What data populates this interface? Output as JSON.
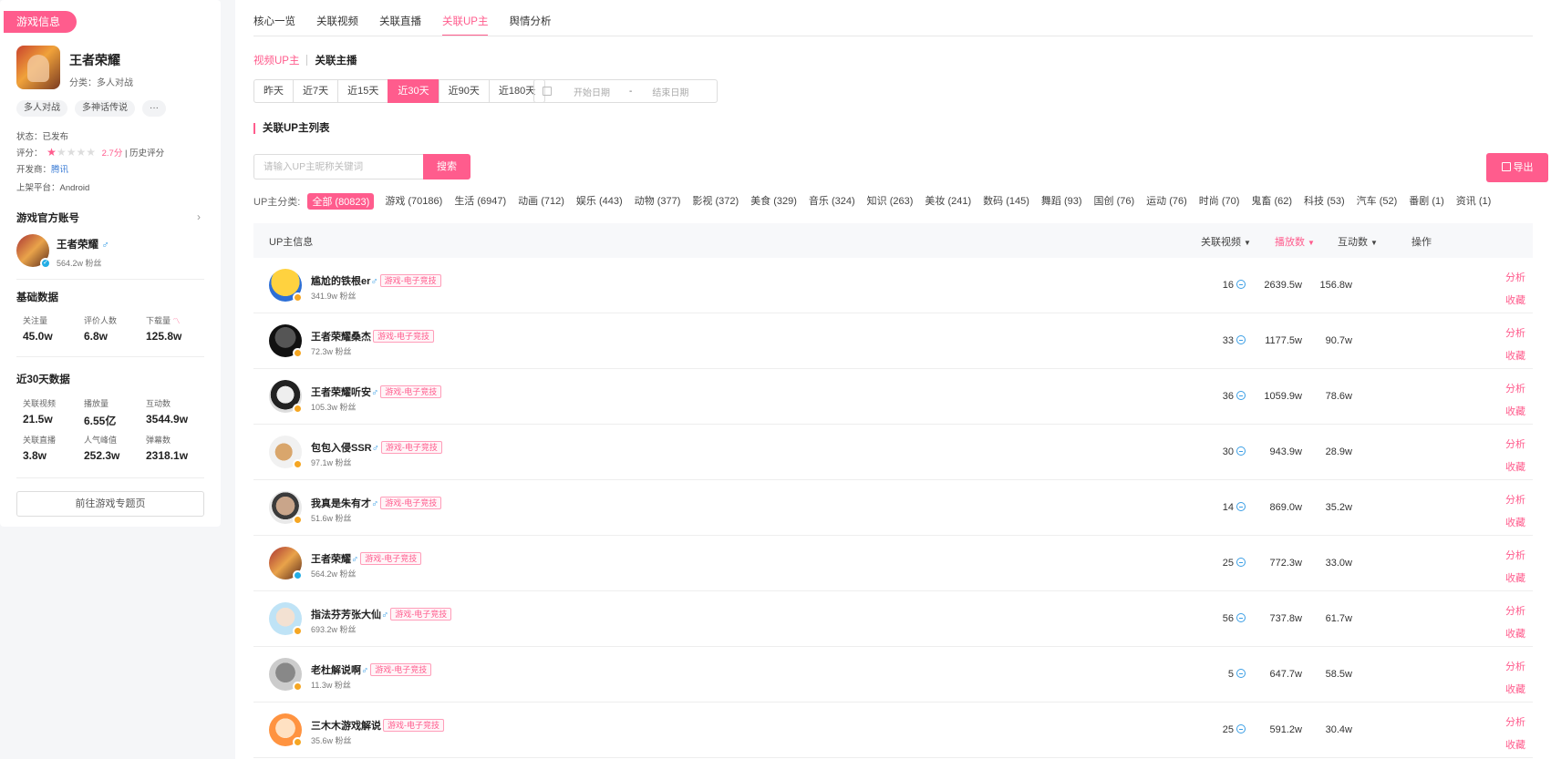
{
  "sidebar": {
    "tag": "游戏信息",
    "game_name": "王者荣耀",
    "category": "分类：多人对战",
    "chips": [
      "多人对战",
      "多神话传说",
      "···"
    ],
    "status": "状态：已发布",
    "rating_label": "评分：",
    "rating_score": "2.7分",
    "rating_history": "| 历史评分",
    "developer_label": "开发商：",
    "developer": "腾讯",
    "platform": "上架平台：Android",
    "official_title": "游戏官方账号",
    "official_name": "王者荣耀",
    "official_fans": "564.2w 粉丝",
    "basic_title": "基础数据",
    "basic": [
      {
        "label": "关注量",
        "value": "45.0w"
      },
      {
        "label": "评价人数",
        "value": "6.8w"
      },
      {
        "label": "下载量",
        "value": "125.8w"
      }
    ],
    "recent_title": "近30天数据",
    "recent": [
      {
        "label": "关联视频",
        "value": "21.5w"
      },
      {
        "label": "播放量",
        "value": "6.55亿"
      },
      {
        "label": "互动数",
        "value": "3544.9w"
      },
      {
        "label": "关联直播",
        "value": "3.8w"
      },
      {
        "label": "人气峰值",
        "value": "252.3w"
      },
      {
        "label": "弹幕数",
        "value": "2318.1w"
      }
    ],
    "goto_button": "前往游戏专题页"
  },
  "tabs": [
    "核心一览",
    "关联视频",
    "关联直播",
    "关联UP主",
    "舆情分析"
  ],
  "subtabs": [
    "视频UP主",
    "关联主播"
  ],
  "ranges": [
    "昨天",
    "近7天",
    "近15天",
    "近30天",
    "近90天",
    "近180天"
  ],
  "date": {
    "start": "开始日期",
    "sep": "-",
    "end": "结束日期"
  },
  "list_title": "关联UP主列表",
  "search": {
    "placeholder": "请输入UP主昵称关键词",
    "button": "搜索"
  },
  "export": "导出",
  "cats_label": "UP主分类:",
  "categories": [
    "全部 (80823)",
    "游戏 (70186)",
    "生活 (6947)",
    "动画 (712)",
    "娱乐 (443)",
    "动物 (377)",
    "影视 (372)",
    "美食 (329)",
    "音乐 (324)",
    "知识 (263)",
    "美妆 (241)",
    "数码 (145)",
    "舞蹈 (93)",
    "国创 (76)",
    "运动 (76)",
    "时尚 (70)",
    "鬼畜 (62)",
    "科技 (53)",
    "汽车 (52)",
    "番剧 (1)",
    "资讯 (1)"
  ],
  "table_head": {
    "info": "UP主信息",
    "videos": "关联视频",
    "plays": "播放数",
    "interactions": "互动数",
    "ops": "操作"
  },
  "rows": [
    {
      "name": "尴尬的铁根er",
      "male": "♂",
      "tag": "游戏-电子竞技",
      "fans": "341.9w 粉丝",
      "videos": "16",
      "plays": "2639.5w",
      "inter": "156.8w"
    },
    {
      "name": "王者荣耀桑杰",
      "male": "",
      "tag": "游戏-电子竞技",
      "fans": "72.3w 粉丝",
      "videos": "33",
      "plays": "1177.5w",
      "inter": "90.7w"
    },
    {
      "name": "王者荣耀听安",
      "male": "♂",
      "tag": "游戏-电子竞技",
      "fans": "105.3w 粉丝",
      "videos": "36",
      "plays": "1059.9w",
      "inter": "78.6w"
    },
    {
      "name": "包包入侵SSR",
      "male": "♂",
      "tag": "游戏-电子竞技",
      "fans": "97.1w 粉丝",
      "videos": "30",
      "plays": "943.9w",
      "inter": "28.9w"
    },
    {
      "name": "我真是朱有才",
      "male": "♂",
      "tag": "游戏-电子竞技",
      "fans": "51.6w 粉丝",
      "videos": "14",
      "plays": "869.0w",
      "inter": "35.2w"
    },
    {
      "name": "王者荣耀",
      "male": "♂",
      "tag": "游戏-电子竞技",
      "fans": "564.2w 粉丝",
      "videos": "25",
      "plays": "772.3w",
      "inter": "33.0w"
    },
    {
      "name": "指法芬芳张大仙",
      "male": "♂",
      "tag": "游戏-电子竞技",
      "fans": "693.2w 粉丝",
      "videos": "56",
      "plays": "737.8w",
      "inter": "61.7w"
    },
    {
      "name": "老杜解说啊",
      "male": "♂",
      "tag": "游戏-电子竞技",
      "fans": "11.3w 粉丝",
      "videos": "5",
      "plays": "647.7w",
      "inter": "58.5w"
    },
    {
      "name": "三木木游戏解说",
      "male": "",
      "tag": "游戏-电子竞技",
      "fans": "35.6w 粉丝",
      "videos": "25",
      "plays": "591.2w",
      "inter": "30.4w"
    }
  ],
  "ops": {
    "analyze": "分析",
    "collect": "收藏"
  },
  "colors": {
    "accent": "#ff5c8d",
    "blue": "#3a9ee5"
  }
}
